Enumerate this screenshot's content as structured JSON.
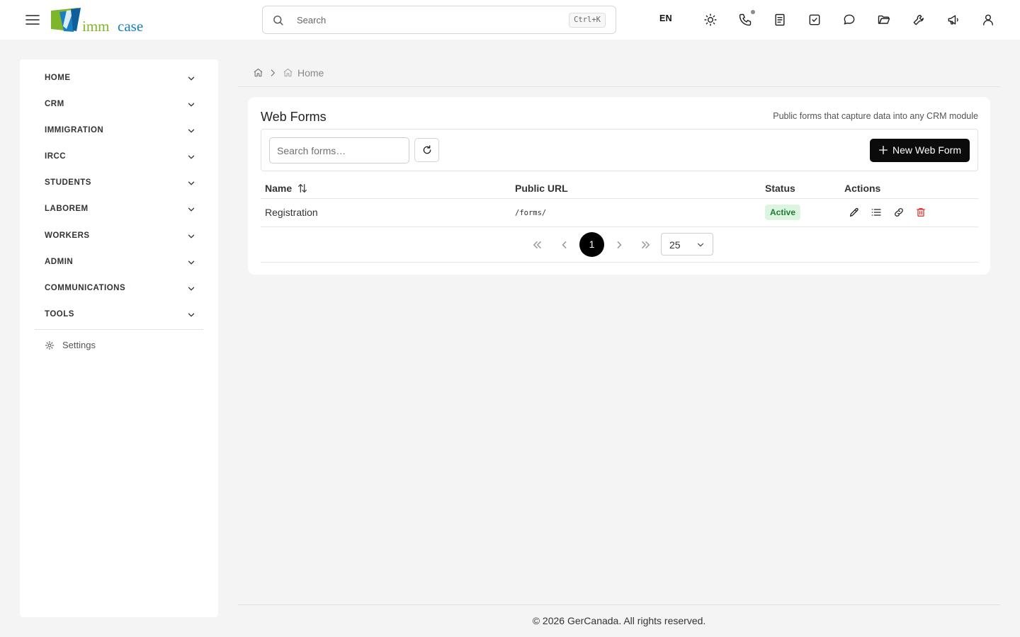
{
  "header": {
    "search_placeholder": "Search",
    "search_shortcut": "Ctrl+K",
    "language": "EN",
    "logo": {
      "part1": "imm",
      "part2": "case"
    },
    "icons": [
      "menu-icon",
      "sun-icon",
      "phone-icon",
      "notes-icon",
      "tasks-icon",
      "chat-icon",
      "folder-icon",
      "wrench-icon",
      "megaphone-icon",
      "user-icon"
    ]
  },
  "sidebar": {
    "items": [
      {
        "label": "HOME"
      },
      {
        "label": "CRM"
      },
      {
        "label": "IMMIGRATION"
      },
      {
        "label": "IRCC"
      },
      {
        "label": "STUDENTS"
      },
      {
        "label": "LABOREM"
      },
      {
        "label": "WORKERS"
      },
      {
        "label": "ADMIN"
      },
      {
        "label": "COMMUNICATIONS"
      },
      {
        "label": "TOOLS"
      }
    ],
    "settings_label": "Settings"
  },
  "breadcrumb": {
    "current": "Home"
  },
  "card": {
    "title": "Web Forms",
    "subtitle": "Public forms that capture data into any CRM module",
    "filter_placeholder": "Search forms…",
    "new_button": "New Web Form"
  },
  "table": {
    "columns": [
      "Name",
      "Public URL",
      "Status",
      "Actions"
    ],
    "rows": [
      {
        "name": "Registration",
        "url": "/forms/",
        "status": "Active",
        "actions": [
          "edit-icon",
          "list-icon",
          "link-icon",
          "trash-icon"
        ]
      }
    ]
  },
  "pagination": {
    "current_page": "1",
    "page_size": "25"
  },
  "footer": {
    "text": "© 2026 GerCanada. All rights reserved."
  },
  "colors": {
    "accent": "#000000",
    "badge_bg": "#dcf5e0",
    "badge_text": "#1f7a32",
    "danger": "#e53935",
    "logo_green": "#7db52b",
    "logo_blue": "#1a7fc1"
  }
}
